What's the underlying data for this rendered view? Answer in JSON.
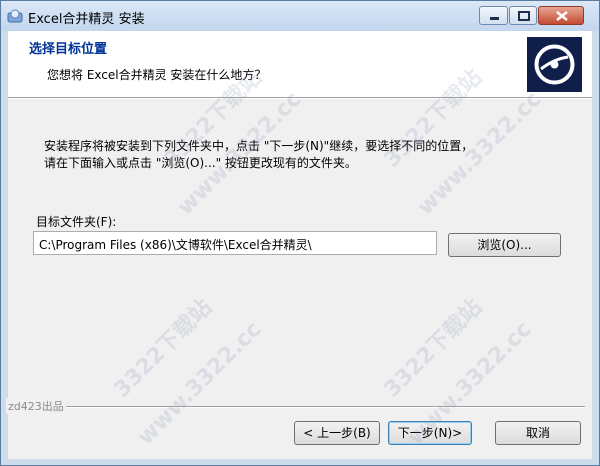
{
  "window": {
    "title": "Excel合并精灵 安装",
    "controls": {
      "minimize": "minimize",
      "maximize": "maximize",
      "close": "close"
    }
  },
  "header": {
    "title": "选择目标位置",
    "subtitle": "您想将 Excel合并精灵 安装在什么地方？",
    "logo_icon": "disc-icon"
  },
  "body": {
    "info_line1": "安装程序将被安装到下列文件夹中，点击 \"下一步(N)\"继续，要选择不同的位置，",
    "info_line2": "请在下面输入或点击 \"浏览(O)...\" 按钮更改现有的文件夹。",
    "dest_label": "目标文件夹(F):",
    "dest_path": "C:\\Program Files (x86)\\文博软件\\Excel合并精灵\\",
    "browse_label": "浏览(O)..."
  },
  "footer": {
    "brand": "zd423出品",
    "back_label": "< 上一步(B)",
    "next_label": "下一步(N)>",
    "cancel_label": "取消"
  },
  "watermark": [
    "3322下载站",
    "www.3322.cc"
  ]
}
